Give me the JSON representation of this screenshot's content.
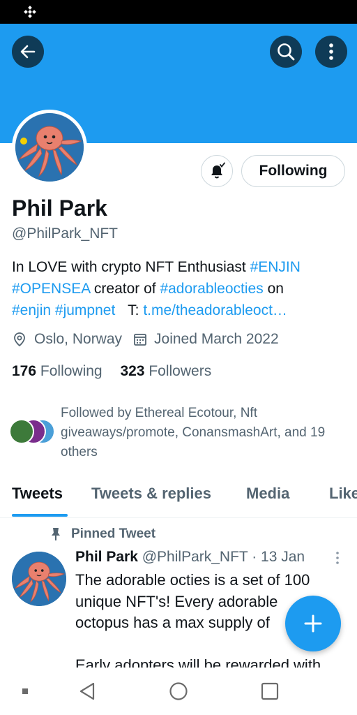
{
  "profile": {
    "name": "Phil Park",
    "handle": "@PhilPark_NFT",
    "following_button": "Following",
    "bio": {
      "line1_text": "In LOVE with crypto NFT Enthusiast ",
      "line1_tag": "#ENJIN",
      "line2_tag": "#OPENSEA",
      "line2_text": " creator of ",
      "line2_tag2": "#adorableocties",
      "line2_text2": " on",
      "line3_tag": "#enjin",
      "line3_tag2": "#jumpnet",
      "line3_text": "T: ",
      "line3_link": "t.me/theadorableoct…"
    },
    "location": "Oslo, Norway",
    "joined": "Joined March 2022",
    "following_count": "176",
    "following_label": "Following",
    "followers_count": "323",
    "followers_label": "Followers",
    "followed_by": "Followed by Ethereal Ecotour, Nft giveaways/promote, ConansmashArt, and 19 others"
  },
  "tabs": [
    "Tweets",
    "Tweets & replies",
    "Media",
    "Likes"
  ],
  "tweet": {
    "pinned_label": "Pinned Tweet",
    "author": "Phil Park",
    "handle_date": "@PhilPark_NFT · 13 Jan",
    "lines": [
      "The adorable octies is a set of 100",
      "unique NFT's! Every adorable",
      "octopus has a max supply of",
      "",
      "Early adopters will be rewarded with"
    ]
  },
  "icons": {
    "back": "back-arrow-icon",
    "search": "search-icon",
    "more": "more-vertical-icon",
    "bell": "notification-bell-icon",
    "location": "location-pin-icon",
    "calendar": "calendar-icon",
    "pin": "pin-icon",
    "compose": "plus-icon"
  },
  "colors": {
    "accent": "#1d9bf0",
    "banner": "#1d9bf0",
    "text_secondary": "#536471"
  }
}
